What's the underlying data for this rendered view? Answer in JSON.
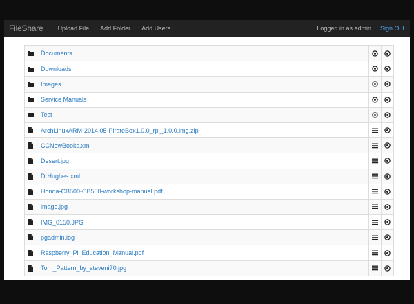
{
  "navbar": {
    "brand": "FileShare",
    "links": [
      "Upload File",
      "Add Folder",
      "Add Users"
    ],
    "logged_in_text": "Logged in as admin",
    "signout_label": "Sign Out"
  },
  "files": [
    {
      "type": "folder",
      "name": "Documents",
      "action1": "view-icon",
      "action2": "view-icon"
    },
    {
      "type": "folder",
      "name": "Downloads",
      "action1": "view-icon",
      "action2": "view-icon"
    },
    {
      "type": "folder",
      "name": "Images",
      "action1": "view-icon",
      "action2": "view-icon"
    },
    {
      "type": "folder",
      "name": "Service Manuals",
      "action1": "view-icon",
      "action2": "view-icon"
    },
    {
      "type": "folder",
      "name": "Test",
      "action1": "view-icon",
      "action2": "view-icon"
    },
    {
      "type": "file",
      "name": "ArchLinuxARM-2014.05-PirateBox1.0.0_rpi_1.0.0.img.zip",
      "action1": "list-icon",
      "action2": "view-icon"
    },
    {
      "type": "file",
      "name": "CCNewBooks.xml",
      "action1": "list-icon",
      "action2": "view-icon"
    },
    {
      "type": "file",
      "name": "Desert.jpg",
      "action1": "list-icon",
      "action2": "view-icon"
    },
    {
      "type": "file",
      "name": "DrHughes.xml",
      "action1": "list-icon",
      "action2": "view-icon"
    },
    {
      "type": "file",
      "name": "Honda-CB500-CB550-workshop-manual.pdf",
      "action1": "list-icon",
      "action2": "view-icon"
    },
    {
      "type": "file",
      "name": "image.jpg",
      "action1": "list-icon",
      "action2": "view-icon"
    },
    {
      "type": "file",
      "name": "IMG_0150.JPG",
      "action1": "list-icon",
      "action2": "view-icon"
    },
    {
      "type": "file",
      "name": "pgadmin.log",
      "action1": "list-icon",
      "action2": "view-icon"
    },
    {
      "type": "file",
      "name": "Raspberry_Pi_Education_Manual.pdf",
      "action1": "list-icon",
      "action2": "view-icon"
    },
    {
      "type": "file",
      "name": "Torn_Pattern_by_steveni70.jpg",
      "action1": "list-icon",
      "action2": "view-icon"
    }
  ],
  "colors": {
    "navbar_bg": "#222222",
    "link": "#2a7ac0",
    "signout": "#4aa3ee"
  }
}
